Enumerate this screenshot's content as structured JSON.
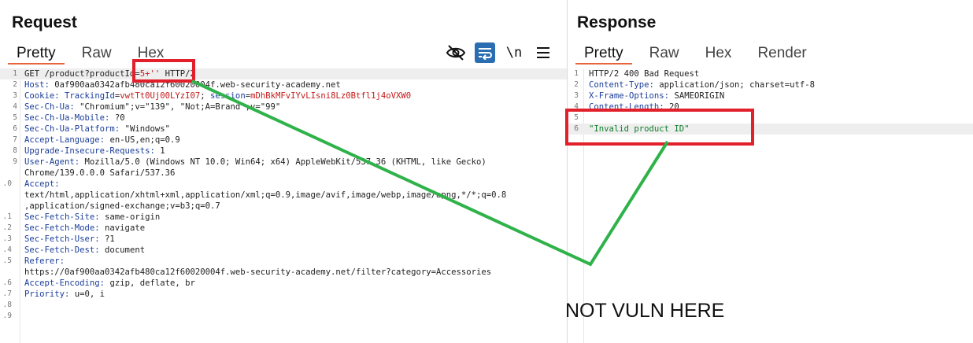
{
  "request": {
    "title": "Request",
    "tabs": [
      "Pretty",
      "Raw",
      "Hex"
    ],
    "active_tab": "Pretty",
    "tools": [
      "eye-off-icon",
      "wrap-lines-icon",
      "newline-icon",
      "menu-icon"
    ],
    "newline_label": "\\n",
    "lines": [
      {
        "n": "1",
        "parts": [
          [
            "v",
            "GET /product?productId="
          ],
          [
            "r",
            "5+''"
          ],
          [
            "v",
            " HTTP/2"
          ]
        ]
      },
      {
        "n": "2",
        "parts": [
          [
            "k",
            "Host:"
          ],
          [
            "v",
            " 0af900aa0342afb480ca12f60020004f.web-security-academy.net"
          ]
        ]
      },
      {
        "n": "3",
        "parts": [
          [
            "k",
            "Cookie:"
          ],
          [
            "v",
            " "
          ],
          [
            "k",
            "TrackingId"
          ],
          [
            "v",
            "="
          ],
          [
            "r",
            "vwtTt0Uj00LYzI07"
          ],
          [
            "v",
            "; "
          ],
          [
            "k",
            "session"
          ],
          [
            "v",
            "="
          ],
          [
            "r",
            "mDhBkMFvIYvLIsni8Lz0Btfl1j4oVXW0"
          ]
        ]
      },
      {
        "n": "4",
        "parts": [
          [
            "k",
            "Sec-Ch-Ua:"
          ],
          [
            "v",
            " \"Chromium\";v=\"139\", \"Not;A=Brand\";v=\"99\""
          ]
        ]
      },
      {
        "n": "5",
        "parts": [
          [
            "k",
            "Sec-Ch-Ua-Mobile:"
          ],
          [
            "v",
            " ?0"
          ]
        ]
      },
      {
        "n": "6",
        "parts": [
          [
            "k",
            "Sec-Ch-Ua-Platform:"
          ],
          [
            "v",
            " \"Windows\""
          ]
        ]
      },
      {
        "n": "7",
        "parts": [
          [
            "k",
            "Accept-Language:"
          ],
          [
            "v",
            " en-US,en;q=0.9"
          ]
        ]
      },
      {
        "n": "8",
        "parts": [
          [
            "k",
            "Upgrade-Insecure-Requests:"
          ],
          [
            "v",
            " 1"
          ]
        ]
      },
      {
        "n": "9",
        "parts": [
          [
            "k",
            "User-Agent:"
          ],
          [
            "v",
            " Mozilla/5.0 (Windows NT 10.0; Win64; x64) AppleWebKit/537.36 (KHTML, like Gecko)"
          ]
        ]
      },
      {
        "n": "",
        "parts": [
          [
            "v",
            "Chrome/139.0.0.0 Safari/537.36"
          ]
        ]
      },
      {
        "n": ".0",
        "parts": [
          [
            "k",
            "Accept:"
          ]
        ]
      },
      {
        "n": "",
        "parts": [
          [
            "v",
            "text/html,application/xhtml+xml,application/xml;q=0.9,image/avif,image/webp,image/apng,*/*;q=0.8"
          ]
        ]
      },
      {
        "n": "",
        "parts": [
          [
            "v",
            ",application/signed-exchange;v=b3;q=0.7"
          ]
        ]
      },
      {
        "n": ".1",
        "parts": [
          [
            "k",
            "Sec-Fetch-Site:"
          ],
          [
            "v",
            " same-origin"
          ]
        ]
      },
      {
        "n": ".2",
        "parts": [
          [
            "k",
            "Sec-Fetch-Mode:"
          ],
          [
            "v",
            " navigate"
          ]
        ]
      },
      {
        "n": ".3",
        "parts": [
          [
            "k",
            "Sec-Fetch-User:"
          ],
          [
            "v",
            " ?1"
          ]
        ]
      },
      {
        "n": ".4",
        "parts": [
          [
            "k",
            "Sec-Fetch-Dest:"
          ],
          [
            "v",
            " document"
          ]
        ]
      },
      {
        "n": ".5",
        "parts": [
          [
            "k",
            "Referer:"
          ]
        ]
      },
      {
        "n": "",
        "parts": [
          [
            "v",
            "https://0af900aa0342afb480ca12f60020004f.web-security-academy.net/filter?category=Accessories"
          ]
        ]
      },
      {
        "n": ".6",
        "parts": [
          [
            "k",
            "Accept-Encoding:"
          ],
          [
            "v",
            " gzip, deflate, br"
          ]
        ]
      },
      {
        "n": ".7",
        "parts": [
          [
            "k",
            "Priority:"
          ],
          [
            "v",
            " u=0, i"
          ]
        ]
      },
      {
        "n": ".8",
        "parts": []
      },
      {
        "n": ".9",
        "parts": []
      }
    ]
  },
  "response": {
    "title": "Response",
    "tabs": [
      "Pretty",
      "Raw",
      "Hex",
      "Render"
    ],
    "active_tab": "Pretty",
    "lines": [
      {
        "n": "1",
        "parts": [
          [
            "v",
            "HTTP/2 400 Bad Request"
          ]
        ]
      },
      {
        "n": "2",
        "parts": [
          [
            "k",
            "Content-Type:"
          ],
          [
            "v",
            " application/json; charset=utf-8"
          ]
        ]
      },
      {
        "n": "3",
        "parts": [
          [
            "k",
            "X-Frame-Options:"
          ],
          [
            "v",
            " SAMEORIGIN"
          ]
        ]
      },
      {
        "n": "4",
        "parts": [
          [
            "k",
            "Content-Length:"
          ],
          [
            "v",
            " 20"
          ]
        ]
      },
      {
        "n": "5",
        "parts": []
      },
      {
        "n": "6",
        "parts": [
          [
            "s",
            "\"Invalid product ID\""
          ]
        ]
      }
    ]
  },
  "annotation": {
    "note": "NOT VULN HERE",
    "box_color": "#e2202b",
    "arrow_color": "#2fb24a"
  },
  "colors": {
    "header_key": "#1b3e9a",
    "red_value": "#c41a1a",
    "string": "#0e7d2a",
    "tab_underline": "#e8643c",
    "wrap_button": "#2a6db1"
  }
}
